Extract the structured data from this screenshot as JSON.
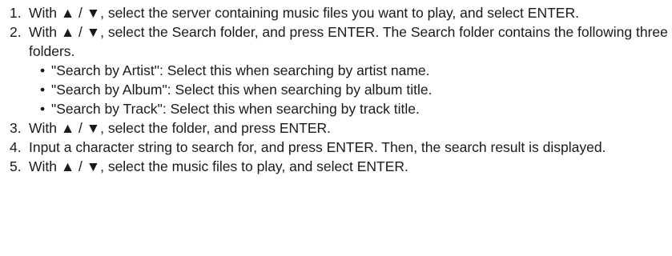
{
  "steps": [
    {
      "number": "1.",
      "text": "With ▲ / ▼, select the server containing music files you want to play, and select ENTER."
    },
    {
      "number": "2.",
      "text": "With ▲ / ▼, select the Search folder, and press ENTER. The Search folder contains the following three folders.",
      "bullets": [
        "\"Search by Artist\": Select this when searching by artist name.",
        "\"Search by Album\": Select this when searching by album title.",
        "\"Search by Track\": Select this when searching by track title."
      ]
    },
    {
      "number": "3.",
      "text": "With ▲ / ▼, select the folder, and press ENTER."
    },
    {
      "number": "4.",
      "text": "Input a character string to search for, and press ENTER. Then, the search result is displayed."
    },
    {
      "number": "5.",
      "text": "With ▲ / ▼, select the music files to play, and select ENTER."
    }
  ],
  "bullet_glyph": "•"
}
